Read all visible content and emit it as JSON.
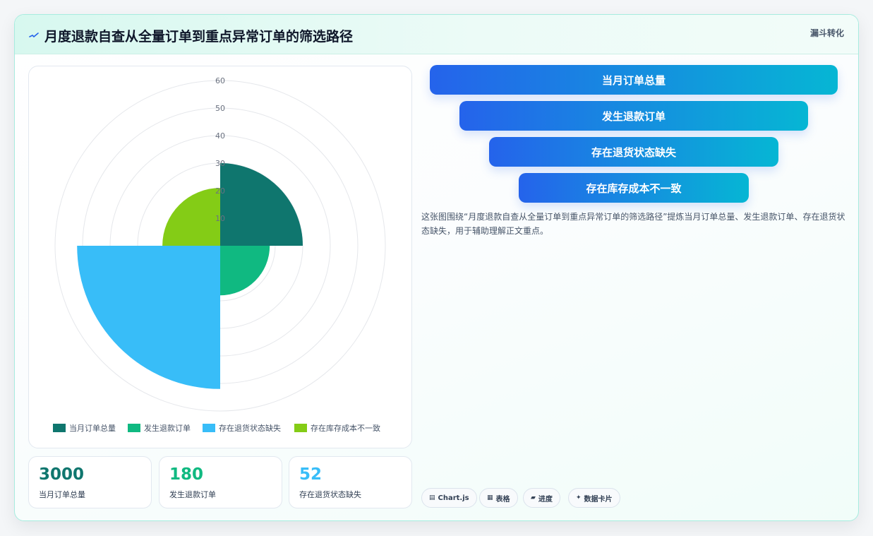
{
  "header": {
    "title": "月度退款自查从全量订单到重点异常订单的筛选路径",
    "tag": "漏斗转化"
  },
  "chart_data": {
    "type": "polarArea",
    "categories": [
      "当月订单总量",
      "发生退款订单",
      "存在退货状态缺失",
      "存在库存成本不一致"
    ],
    "values": [
      30,
      18,
      52,
      21
    ],
    "colors": [
      "#0f766e",
      "#10b981",
      "#38bdf8",
      "#84cc16"
    ],
    "r_ticks": [
      10,
      20,
      30,
      40,
      50,
      60
    ],
    "r_max": 60,
    "legend_position": "bottom"
  },
  "stats": [
    {
      "value": "3000",
      "label": "当月订单总量",
      "color": "#0f766e"
    },
    {
      "value": "180",
      "label": "发生退款订单",
      "color": "#10b981"
    },
    {
      "value": "52",
      "label": "存在退货状态缺失",
      "color": "#38bdf8"
    }
  ],
  "funnel": [
    "当月订单总量",
    "发生退款订单",
    "存在退货状态缺失",
    "存在库存成本不一致"
  ],
  "description": "这张图围绕“月度退款自查从全量订单到重点异常订单的筛选路径”提炼当月订单总量、发生退款订单、存在退货状态缺失，用于辅助理解正文重点。",
  "pills": [
    {
      "icon": "chart-icon",
      "glyph": "▤",
      "label": "Chart.js"
    },
    {
      "icon": "table-icon",
      "glyph": "▦",
      "label": "表格"
    },
    {
      "icon": "progress-icon",
      "glyph": "▰",
      "label": "进度"
    },
    {
      "icon": "sparkle-icon",
      "glyph": "✦",
      "label": "数据卡片"
    }
  ]
}
